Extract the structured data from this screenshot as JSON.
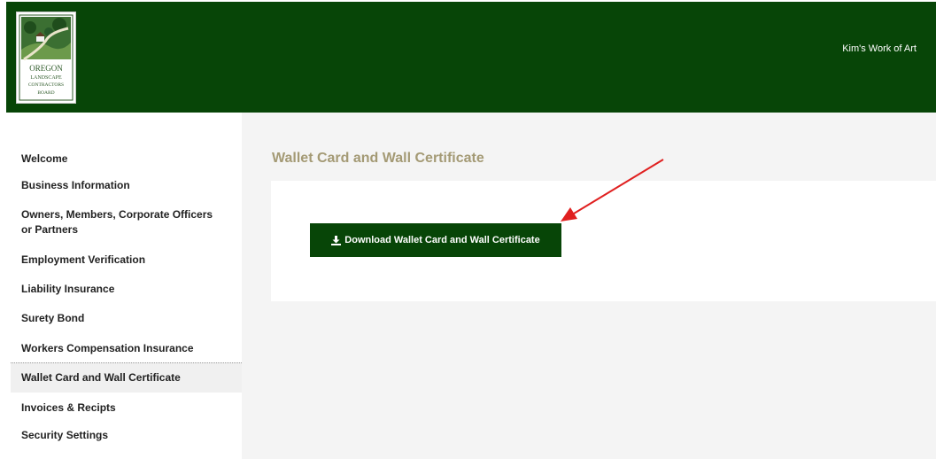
{
  "header": {
    "logo_lines": [
      "OREGON",
      "LANDSCAPE",
      "CONTRACTORS",
      "BOARD"
    ],
    "account_name": "Kim's Work of Art"
  },
  "sidebar": {
    "items": [
      {
        "label": "Welcome"
      },
      {
        "label": "Business Information"
      },
      {
        "label": "Owners, Members, Corporate Officers or Partners"
      },
      {
        "label": "Employment Verification"
      },
      {
        "label": "Liability Insurance"
      },
      {
        "label": "Surety Bond"
      },
      {
        "label": "Workers Compensation Insurance"
      },
      {
        "label": "Wallet Card and Wall Certificate",
        "active": true
      },
      {
        "label": "Invoices & Recipts"
      },
      {
        "label": "Security Settings"
      }
    ]
  },
  "main": {
    "title": "Wallet Card and Wall Certificate",
    "download_button": {
      "label": "Download Wallet Card and Wall Certificate",
      "icon": "download-icon"
    }
  },
  "colors": {
    "brand_green": "#074507",
    "title_tan": "#a49a75",
    "annotation_red": "#e02020",
    "content_bg": "#f4f4f4"
  }
}
